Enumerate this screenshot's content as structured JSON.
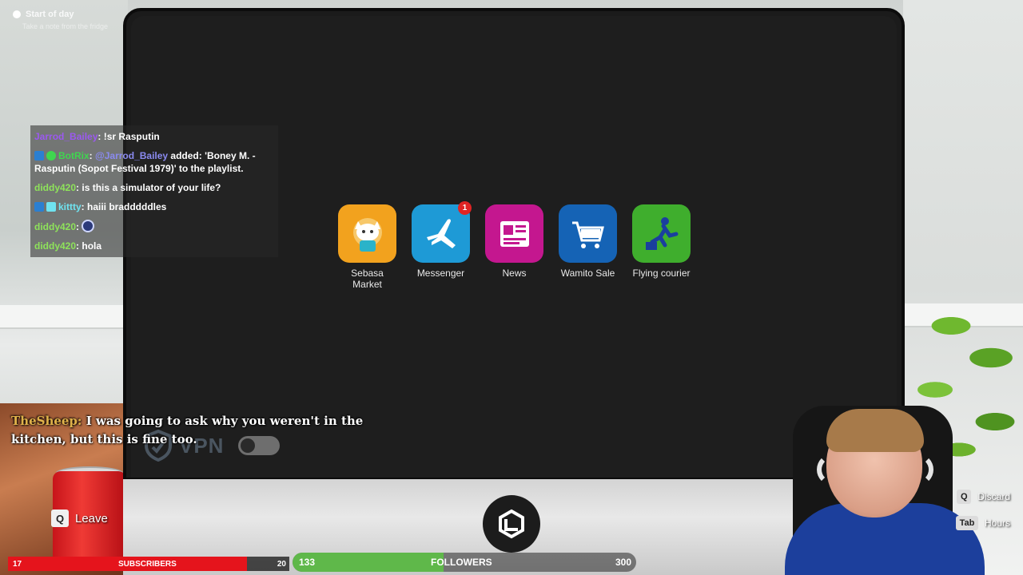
{
  "objective": {
    "title": "Start of day",
    "subtitle": "Take a note from the fridge"
  },
  "chat": {
    "messages": [
      {
        "user": "Jarrod_Bailey",
        "user_color": "#9b59f0",
        "text": ": !sr Rasputin"
      },
      {
        "user": "BotRix",
        "user_color": "#3fd64f",
        "sep": ": ",
        "mention": "@Jarrod_Bailey",
        "text": " added: 'Boney M. - Rasputin (Sopot Festival 1979)' to the playlist."
      },
      {
        "user": "diddy420",
        "user_color": "#8ee35a",
        "text": ": is this a simulator of your life?"
      },
      {
        "user": "kittty",
        "user_color": "#6fe3f0",
        "text": ": haiii bradddddles"
      },
      {
        "user": "diddy420",
        "user_color": "#8ee35a",
        "text": ": "
      },
      {
        "user": "diddy420",
        "user_color": "#8ee35a",
        "text": ": hola"
      }
    ]
  },
  "apps": [
    {
      "label": "Sebasa Market",
      "icon": "cat-shopping-bag-icon",
      "bg": "#f2a21e"
    },
    {
      "label": "Messenger",
      "icon": "airplane-icon",
      "bg": "#1e9ad6",
      "badge": "1"
    },
    {
      "label": "News",
      "icon": "newspaper-icon",
      "bg": "#c4178f"
    },
    {
      "label": "Wamito Sale",
      "icon": "shopping-cart-icon",
      "bg": "#1563b5"
    },
    {
      "label": "Flying courier",
      "icon": "courier-kick-icon",
      "bg": "#3fae2d"
    }
  ],
  "vpn": {
    "label": "VPN",
    "enabled": false
  },
  "subtitle": {
    "speaker": "TheSheep:",
    "text": " I was going to ask why you weren't in the kitchen, but this is fine too."
  },
  "prompts": {
    "leave_key": "Q",
    "leave_label": "Leave",
    "discard_key": "Q",
    "discard_label": "Discard",
    "hours_key": "Tab",
    "hours_label": "Hours"
  },
  "subscribers": {
    "current": "17",
    "label": "SUBSCRIBERS",
    "goal": "20",
    "progress": 0.85,
    "color": "#e5141c"
  },
  "followers": {
    "current": "133",
    "label": "FOLLOWERS",
    "goal": "300",
    "progress": 0.44,
    "color": "#5fb84a"
  }
}
